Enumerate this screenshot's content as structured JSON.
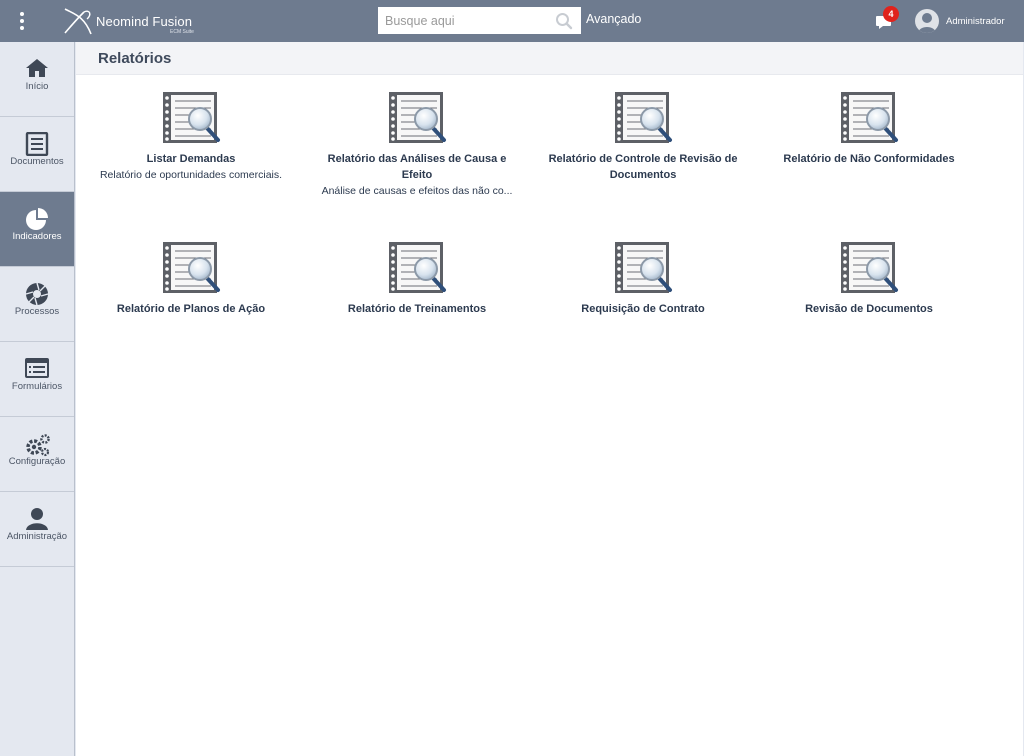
{
  "header": {
    "brand_name": "Neomind Fusion",
    "brand_sub": "ECM Suite",
    "search_placeholder": "Busque aqui",
    "advanced_label": "Avançado",
    "notification_count": "4",
    "user_name": "Administrador"
  },
  "sidebar": {
    "items": [
      {
        "label": "Início",
        "icon": "home-icon"
      },
      {
        "label": "Documentos",
        "icon": "document-icon"
      },
      {
        "label": "Indicadores",
        "icon": "pie-chart-icon",
        "active": true
      },
      {
        "label": "Processos",
        "icon": "aperture-icon"
      },
      {
        "label": "Formulários",
        "icon": "form-list-icon"
      },
      {
        "label": "Configuração",
        "icon": "gears-icon"
      },
      {
        "label": "Administração",
        "icon": "user-icon"
      }
    ]
  },
  "page": {
    "title": "Relatórios"
  },
  "reports": [
    {
      "title": "Listar Demandas",
      "description": "Relatório de oportunidades comerciais."
    },
    {
      "title": "Relatório das Análises de Causa e Efeito",
      "description": "Análise de causas e efeitos das não co..."
    },
    {
      "title": "Relatório de Controle de Revisão de Documentos",
      "description": ""
    },
    {
      "title": "Relatório de Não Conformidades",
      "description": ""
    },
    {
      "title": "Relatório de Planos de Ação",
      "description": ""
    },
    {
      "title": "Relatório de Treinamentos",
      "description": ""
    },
    {
      "title": "Requisição de Contrato",
      "description": ""
    },
    {
      "title": "Revisão de Documentos",
      "description": ""
    }
  ],
  "colors": {
    "topbar": "#6e7b8f",
    "sidebar_bg": "#e4e8f0",
    "active_item": "#6e7b8f",
    "badge": "#e0231d",
    "text_dark": "#2c3a4f"
  }
}
